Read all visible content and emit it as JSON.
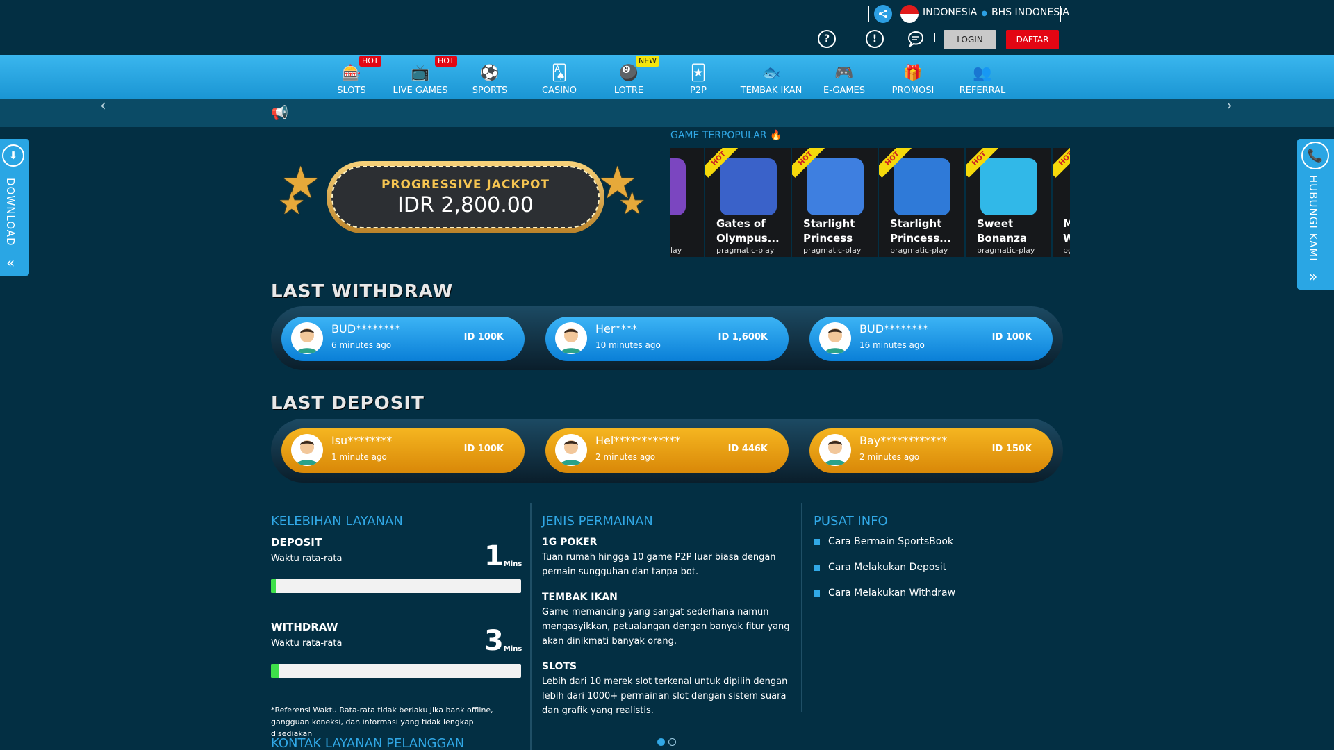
{
  "header": {
    "language": "INDONESIA",
    "language_alt": "BHS INDONESIA",
    "login_label": "LOGIN",
    "register_label": "DAFTAR",
    "help_icon": "?",
    "info_icon": "!"
  },
  "nav": {
    "items": [
      {
        "label": "SLOTS",
        "icon": "slot-machine-icon",
        "badge": "HOT"
      },
      {
        "label": "LIVE GAMES",
        "icon": "live-icon",
        "badge": "HOT"
      },
      {
        "label": "SPORTS",
        "icon": "soccer-ball-icon",
        "badge": ""
      },
      {
        "label": "CASINO",
        "icon": "card-icon",
        "badge": ""
      },
      {
        "label": "LOTRE",
        "icon": "lottery-icon",
        "badge": "NEW"
      },
      {
        "label": "P2P",
        "icon": "cards-icon",
        "badge": ""
      },
      {
        "label": "TEMBAK IKAN",
        "icon": "fish-icon",
        "badge": ""
      },
      {
        "label": "E-GAMES",
        "icon": "gamepad-icon",
        "badge": ""
      },
      {
        "label": "PROMOSI",
        "icon": "gift-icon",
        "badge": ""
      },
      {
        "label": "REFERRAL",
        "icon": "referral-icon",
        "badge": ""
      }
    ]
  },
  "side": {
    "left_label": "DOWNLOAD",
    "right_label": "HUBUNGI KAMI"
  },
  "jackpot": {
    "title": "PROGRESSIVE JACKPOT",
    "value": "IDR 2,800.00"
  },
  "popular": {
    "title": "GAME TERPOPULAR",
    "games": [
      {
        "title": "Gates of Olympus...",
        "provider": "pragmatic-play",
        "color": "#3a62c9"
      },
      {
        "title": "Starlight Princess",
        "provider": "pragmatic-play",
        "color": "#3e7fe0"
      },
      {
        "title": "Starlight Princess...",
        "provider": "pragmatic-play",
        "color": "#2f7ad8"
      },
      {
        "title": "Sweet Bonanza",
        "provider": "pragmatic-play",
        "color": "#31b8e8"
      }
    ],
    "partial_left": {
      "title": "",
      "provider": "lay"
    },
    "partial_right": {
      "title": "M W",
      "provider": "pg"
    }
  },
  "withdraw": {
    "title": "LAST WITHDRAW",
    "items": [
      {
        "name": "BUD********",
        "time": "6 minutes ago",
        "amount": "ID 100K"
      },
      {
        "name": "Her****",
        "time": "10 minutes ago",
        "amount": "ID 1,600K"
      },
      {
        "name": "BUD********",
        "time": "16 minutes ago",
        "amount": "ID 100K"
      }
    ]
  },
  "deposit": {
    "title": "LAST DEPOSIT",
    "items": [
      {
        "name": "Isu********",
        "time": "1 minute ago",
        "amount": "ID 100K"
      },
      {
        "name": "Hel************",
        "time": "2 minutes ago",
        "amount": "ID 446K"
      },
      {
        "name": "Bay************",
        "time": "2 minutes ago",
        "amount": "ID 150K"
      }
    ]
  },
  "service": {
    "title": "KELEBIHAN LAYANAN",
    "deposit_label": "DEPOSIT",
    "deposit_sub": "Waktu rata-rata",
    "deposit_num": "1",
    "deposit_unit": "Mins",
    "deposit_progress": 0.02,
    "withdraw_label": "WITHDRAW",
    "withdraw_sub": "Waktu rata-rata",
    "withdraw_num": "3",
    "withdraw_unit": "Mins",
    "withdraw_progress": 0.03,
    "note": "*Referensi Waktu Rata-rata tidak berlaku jika bank offline, gangguan koneksi, dan informasi yang tidak lengkap disediakan",
    "contact_title": "KONTAK LAYANAN PELANGGAN"
  },
  "games_info": {
    "title": "JENIS PERMAINAN",
    "items": [
      {
        "name": "1G POKER",
        "desc": "Tuan rumah hingga 10 game P2P luar biasa dengan pemain sungguhan dan tanpa bot."
      },
      {
        "name": "TEMBAK IKAN",
        "desc": "Game memancing yang sangat sederhana namun mengasyikkan, petualangan dengan banyak fitur yang akan dinikmati banyak orang."
      },
      {
        "name": "SLOTS",
        "desc": "Lebih dari 10 merek slot terkenal untuk dipilih dengan lebih dari 1000+ permainan slot dengan sistem suara dan grafik yang realistis."
      }
    ]
  },
  "info_center": {
    "title": "PUSAT INFO",
    "links": [
      "Cara Bermain SportsBook",
      "Cara Melakukan Deposit",
      "Cara Melakukan Withdraw"
    ]
  }
}
